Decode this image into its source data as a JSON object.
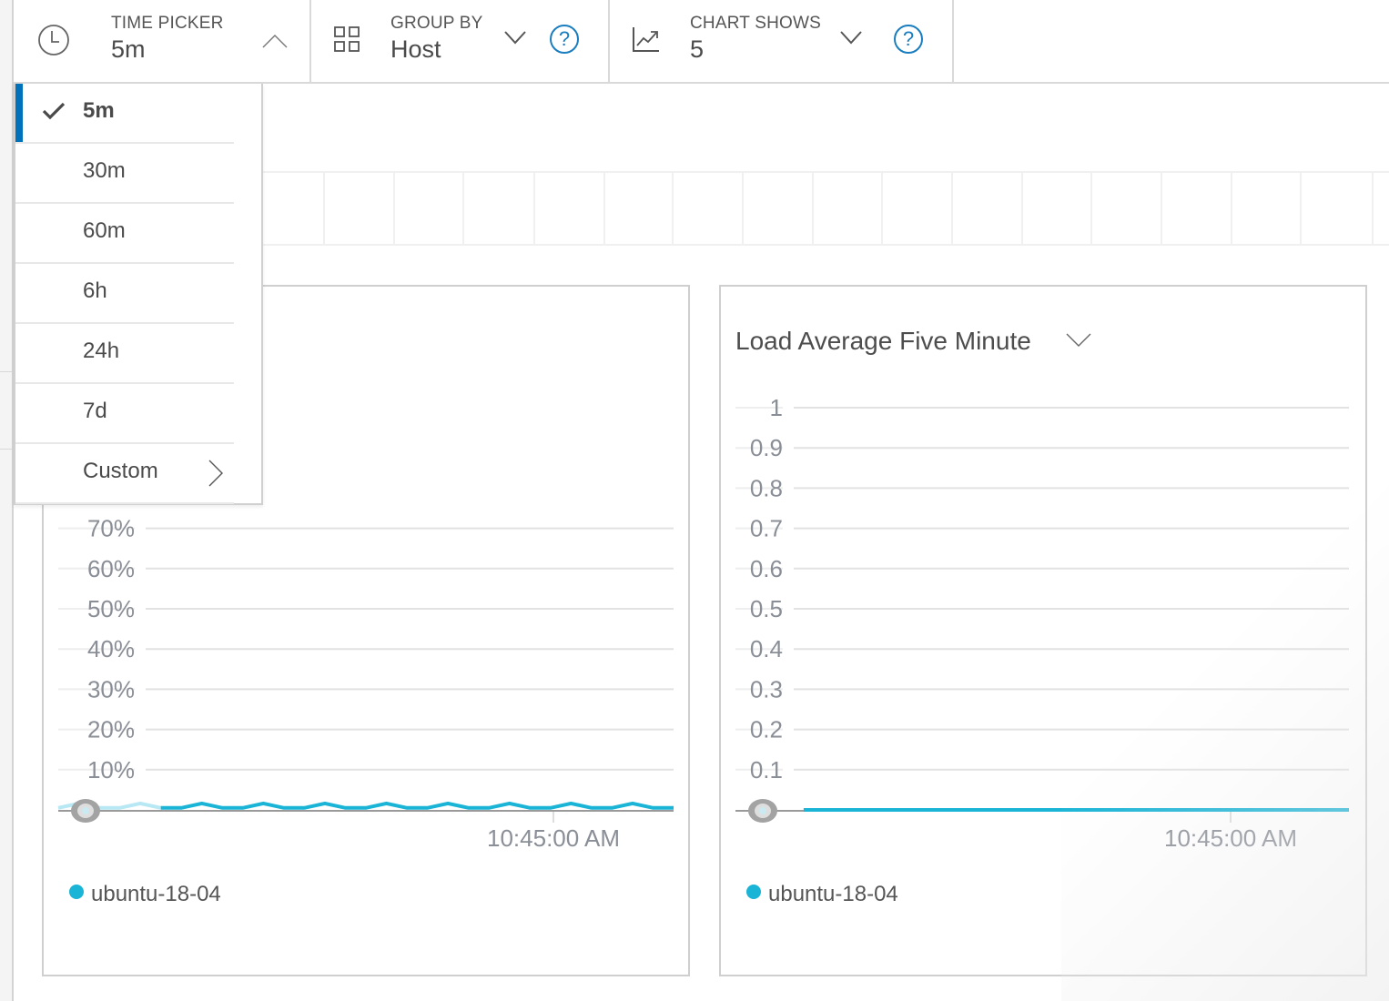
{
  "toolbar": {
    "time_picker": {
      "label": "TIME PICKER",
      "value": "5m",
      "icon": "clock-icon",
      "state": "open"
    },
    "group_by": {
      "label": "GROUP BY",
      "value": "Host",
      "icon": "grid-icon",
      "help": "?"
    },
    "chart_shows": {
      "label": "CHART SHOWS",
      "value": "5",
      "icon": "line-chart-icon",
      "help": "?"
    }
  },
  "time_dropdown": {
    "options": [
      {
        "label": "5m",
        "selected": true
      },
      {
        "label": "30m",
        "selected": false
      },
      {
        "label": "60m",
        "selected": false
      },
      {
        "label": "6h",
        "selected": false
      },
      {
        "label": "24h",
        "selected": false
      },
      {
        "label": "7d",
        "selected": false
      },
      {
        "label": "Custom",
        "selected": false,
        "submenu": true
      }
    ],
    "accent_color": "#0072bb"
  },
  "chart_data": [
    {
      "type": "line",
      "title": "",
      "yticks": [
        "10%",
        "20%",
        "30%",
        "40%",
        "50%",
        "60%",
        "70%"
      ],
      "ylim": [
        0,
        100
      ],
      "xtick_label": "10:45:00 AM",
      "series": [
        {
          "name": "ubuntu-18-04",
          "color": "#1ab4d6",
          "values": [
            0.5,
            1.6,
            0.5,
            0.5,
            1.6,
            0.5,
            0.5,
            1.6,
            0.5,
            0.5,
            1.6,
            0.5,
            0.5,
            1.6,
            0.5,
            0.5,
            1.6,
            0.5,
            0.5,
            1.6,
            0.5,
            0.5,
            1.6,
            0.5,
            0.5,
            1.6,
            0.5,
            0.5,
            1.6,
            0.5,
            0.5
          ]
        }
      ],
      "legend": [
        "ubuntu-18-04"
      ]
    },
    {
      "type": "line",
      "title": "Load Average Five Minute",
      "yticks": [
        "0.1",
        "0.2",
        "0.3",
        "0.4",
        "0.5",
        "0.6",
        "0.7",
        "0.8",
        "0.9",
        "1"
      ],
      "ylim": [
        0,
        1
      ],
      "xtick_label": "10:45:00 AM",
      "series": [
        {
          "name": "ubuntu-18-04",
          "color": "#1ab4d6",
          "values": [
            0,
            0,
            0,
            0,
            0,
            0,
            0,
            0,
            0,
            0
          ]
        }
      ],
      "legend": [
        "ubuntu-18-04"
      ]
    }
  ]
}
